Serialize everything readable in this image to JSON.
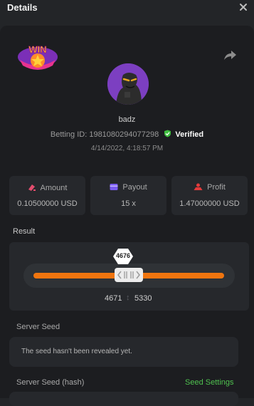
{
  "header": {
    "title": "Details"
  },
  "user": {
    "name": "badz",
    "betting_label": "Betting ID:",
    "betting_id": "1981080294077298",
    "verified_label": "Verified",
    "date": "4/14/2022, 4:18:57 PM"
  },
  "badge": {
    "text": "WIN"
  },
  "stats": {
    "amount": {
      "label": "Amount",
      "value": "0.10500000 USD"
    },
    "payout": {
      "label": "Payout",
      "value": "15 x"
    },
    "profit": {
      "label": "Profit",
      "value": "1.47000000 USD"
    }
  },
  "result": {
    "label": "Result",
    "value": "4676",
    "range_low": "4671",
    "range_high": "5330"
  },
  "server_seed": {
    "label": "Server Seed",
    "text": "The seed hasn't been revealed yet."
  },
  "server_seed_hash": {
    "label": "Server Seed (hash)",
    "settings_label": "Seed Settings"
  },
  "colors": {
    "accent": "#f0750f",
    "verified": "#3fbf3f",
    "seed_settings": "#4fc14f"
  },
  "icons": [
    "close-icon",
    "share-icon",
    "verified-shield-icon",
    "amount-icon",
    "payout-icon",
    "profit-icon"
  ]
}
